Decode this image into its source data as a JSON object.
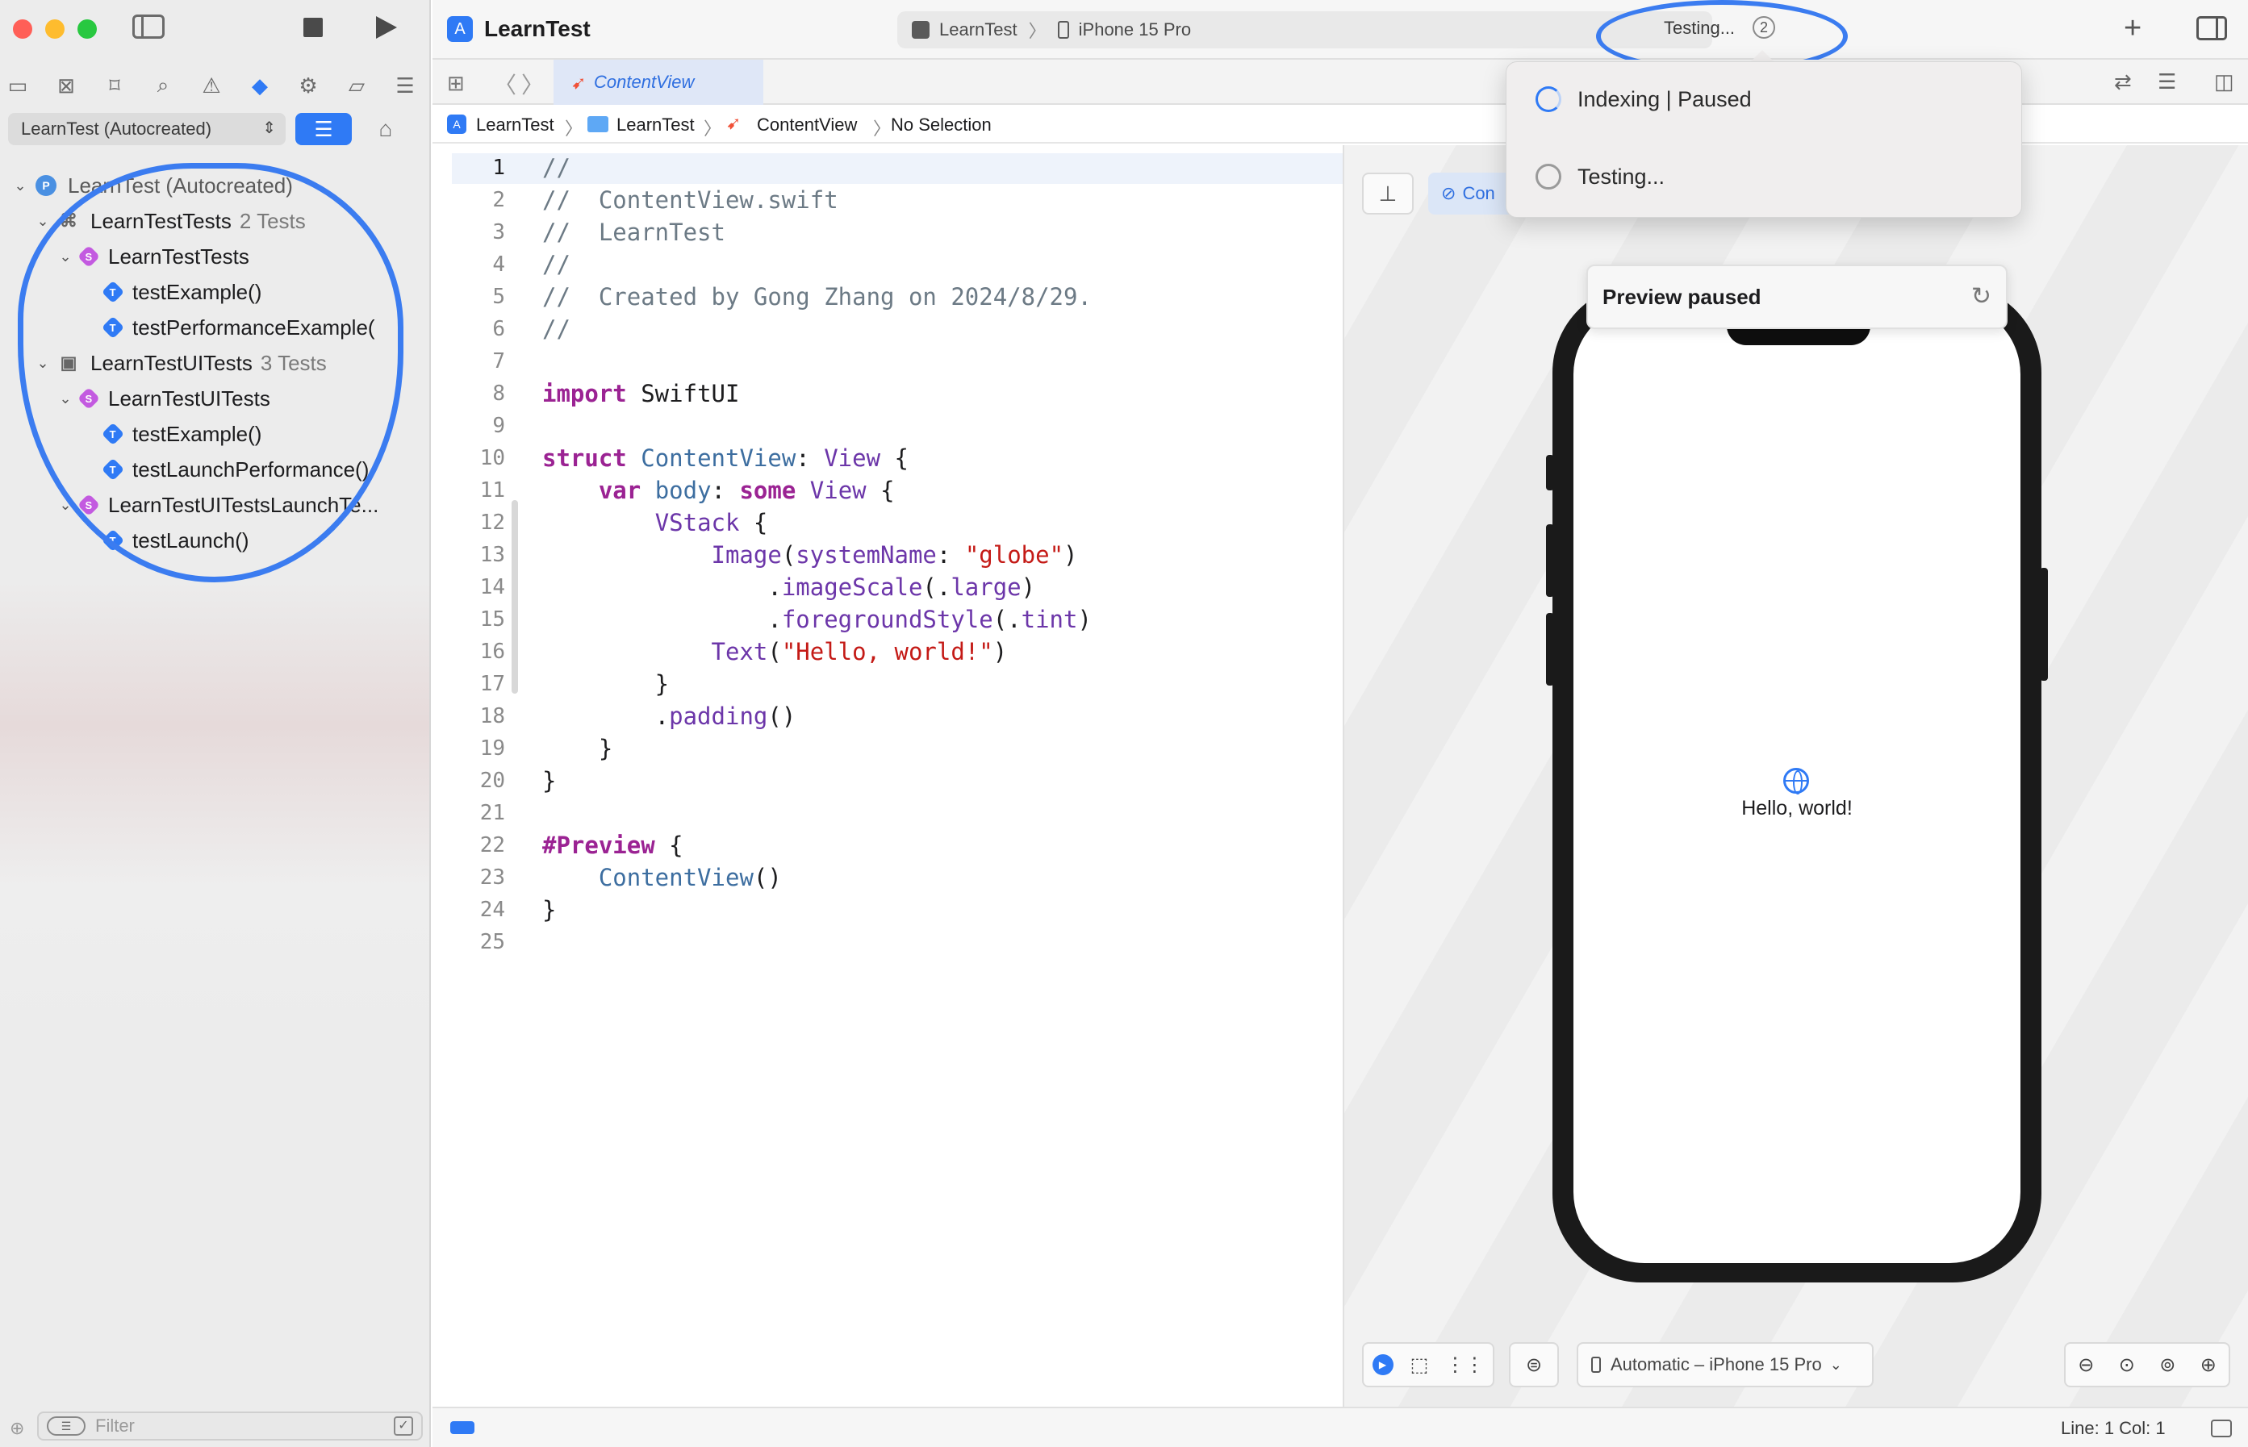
{
  "window": {
    "traffic_colors": [
      "#ff5f57",
      "#febc2e",
      "#28c840"
    ]
  },
  "toolbar": {
    "project_title": "LearnTest",
    "scheme_name": "LearnTest",
    "destination": "iPhone 15 Pro",
    "activity_text": "Testing...",
    "activity_count": "2",
    "add_icon": "plus-icon",
    "inspector_icon": "sidebar-right-icon"
  },
  "sidebar": {
    "scheme_select": "LearnTest (Autocreated)",
    "filter_placeholder": "Filter",
    "tree": [
      {
        "label": "LearnTest (Autocreated)",
        "level": 0,
        "icon": "testplan-icon",
        "count": ""
      },
      {
        "label": "LearnTestTests",
        "level": 1,
        "icon": "test-bundle-icon",
        "count": "2 Tests"
      },
      {
        "label": "LearnTestTests",
        "level": 2,
        "icon": "swift-class-icon",
        "count": ""
      },
      {
        "label": "testExample()",
        "level": 3,
        "icon": "test-method-icon",
        "count": ""
      },
      {
        "label": "testPerformanceExample(",
        "level": 3,
        "icon": "test-method-icon",
        "count": ""
      },
      {
        "label": "LearnTestUITests",
        "level": 1,
        "icon": "ui-test-bundle-icon",
        "count": "3 Tests"
      },
      {
        "label": "LearnTestUITests",
        "level": 2,
        "icon": "swift-class-icon",
        "count": ""
      },
      {
        "label": "testExample()",
        "level": 3,
        "icon": "test-method-icon",
        "count": ""
      },
      {
        "label": "testLaunchPerformance()",
        "level": 3,
        "icon": "test-method-icon",
        "count": ""
      },
      {
        "label": "LearnTestUITestsLaunchTe...",
        "level": 2,
        "icon": "swift-class-icon",
        "count": ""
      },
      {
        "label": "testLaunch()",
        "level": 3,
        "icon": "test-method-icon",
        "count": ""
      }
    ]
  },
  "tabs": [
    {
      "label": "ContentView",
      "active": true
    }
  ],
  "jumpbar": {
    "items": [
      "LearnTest",
      "LearnTest",
      "ContentView",
      "No Selection"
    ]
  },
  "editor": {
    "current_line": "1",
    "lines": [
      "//",
      "//  ContentView.swift",
      "//  LearnTest",
      "//",
      "//  Created by Gong Zhang on 2024/8/29.",
      "//",
      "",
      "import SwiftUI",
      "",
      "struct ContentView: View {",
      "    var body: some View {",
      "        VStack {",
      "            Image(systemName: \"globe\")",
      "                .imageScale(.large)",
      "                .foregroundStyle(.tint)",
      "            Text(\"Hello, world!\")",
      "        }",
      "        .padding()",
      "    }",
      "}",
      "",
      "#Preview {",
      "    ContentView()",
      "}",
      ""
    ]
  },
  "preview": {
    "variant_label": "Con",
    "paused_label": "Preview paused",
    "hello_text": "Hello, world!",
    "device_select": "Automatic – iPhone 15 Pro"
  },
  "popup": {
    "items": [
      "Indexing | Paused",
      "Testing..."
    ]
  },
  "statusbar": {
    "line_col": "Line: 1  Col: 1"
  },
  "accent_color": "#2f7af5",
  "annotation_color": "#3b7cf0"
}
